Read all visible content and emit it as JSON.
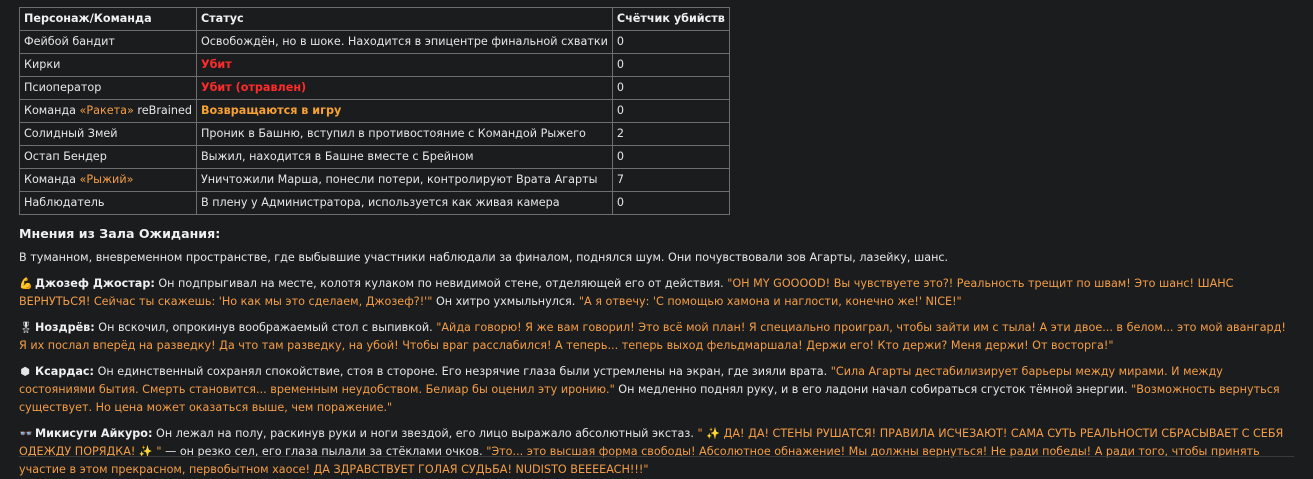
{
  "table": {
    "headers": [
      "Персонаж/Команда",
      "Статус",
      "Счётчик убийств"
    ],
    "rows": [
      {
        "name": "Фейбой бандит",
        "status": "Освобождён, но в шоке. Находится в эпицентре финальной схватки",
        "kills": "0"
      },
      {
        "name": "Кирки",
        "status": "Убит",
        "kills": "0"
      },
      {
        "name": "Псиоператор",
        "status": "Убит (отравлен)",
        "kills": "0"
      },
      {
        "name_prefix": "Команда ",
        "name_accent": "«Ракета»",
        "name_suffix": " reBrained",
        "status": "Возвращаются в игру",
        "kills": "0"
      },
      {
        "name": "Солидный Змей",
        "status": "Проник в Башню, вступил в противостояние с Командой Рыжего",
        "kills": "2"
      },
      {
        "name": "Остап Бендер",
        "status": "Выжил, находится в Башне вместе с Брейном",
        "kills": "0"
      },
      {
        "name_prefix": "Команда ",
        "name_accent": "«Рыжий»",
        "status": "Уничтожили Марша, понесли потери, контролируют Врата Агарты",
        "kills": "7"
      },
      {
        "name": "Наблюдатель",
        "status": "В плену у Администратора, используется как живая камера",
        "kills": "0"
      }
    ]
  },
  "section": {
    "heading": "Мнения из Зала Ожидания:",
    "intro": "В туманном, вневременном пространстве, где выбывшие участники наблюдали за финалом, поднялся шум. Они почувствовали зов Агарты, лазейку, шанс."
  },
  "opinions": [
    {
      "icon": "💪",
      "name": "Джозеф Джостар:",
      "text1": " Он подпрыгивал на месте, колотя кулаком по невидимой стене, отделяющей его от действия. ",
      "quote1": "\"OH MY GOOOOD! Вы чувствуете это?! Реальность трещит по швам! Это шанс! ШАНС ВЕРНУТЬСЯ! Сейчас ты скажешь: 'Но как мы это сделаем, Джозеф?!'\"",
      "text2": " Он хитро ухмыльнулся. ",
      "quote2": "\"А я отвечу: 'С помощью хамона и наглости, конечно же!' NICE!\""
    },
    {
      "icon": "🎖",
      "name": "Ноздрёв:",
      "text1": " Он вскочил, опрокинув воображаемый стол с выпивкой. ",
      "quote1": "\"Айда говорю! Я же вам говорил! Это всё мой план! Я специально проиграл, чтобы зайти им с тыла! А эти двое... в белом... это мой авангард! Я их послал вперёд на разведку! Да что там разведку, на убой! Чтобы враг расслабился! А теперь... теперь выход фельдмаршала! Держи его! Кто держи? Меня держи! От восторга!\"",
      "text2": "",
      "quote2": ""
    },
    {
      "icon": "⬢",
      "name": "Ксардас:",
      "text1": " Он единственный сохранял спокойствие, стоя в стороне. Его незрячие глаза были устремлены на экран, где зияли врата. ",
      "quote1": "\"Сила Агарты дестабилизирует барьеры между мирами. И между состояниями бытия. Смерть становится... временным неудобством. Белиар бы оценил эту иронию.\"",
      "text2": " Он медленно поднял руку, и в его ладони начал собираться сгусток тёмной энергии. ",
      "quote2": "\"Возможность вернуться существует. Но цена может оказаться выше, чем поражение.\""
    },
    {
      "icon": "👓",
      "name": "Микисуги Айкуро:",
      "text1": " Он лежал на полу, раскинув руки и ноги звездой, его лицо выражало абсолютный экстаз. ",
      "quote1": "\" ✨ ДА! ДА! СТЕНЫ РУШАТСЯ! ПРАВИЛА ИСЧЕЗАЮТ! САМА СУТЬ РЕАЛЬНОСТИ СБРАСЫВАЕТ С СЕБЯ ОДЕЖДУ ПОРЯДКА! ✨ \"",
      "text2": " — он резко сел, его глаза пылали за стёклами очков. ",
      "quote2": "\"Это... это высшая форма свободы! Абсолютное обнажение! Мы должны вернуться! Не ради победы! А ради того, чтобы принять участие в этом прекрасном, первобытном хаосе! ДА ЗДРАВСТВУЕТ ГОЛАЯ СУДЬБА! NUDISTO BEEEEACH!!!\""
    }
  ]
}
